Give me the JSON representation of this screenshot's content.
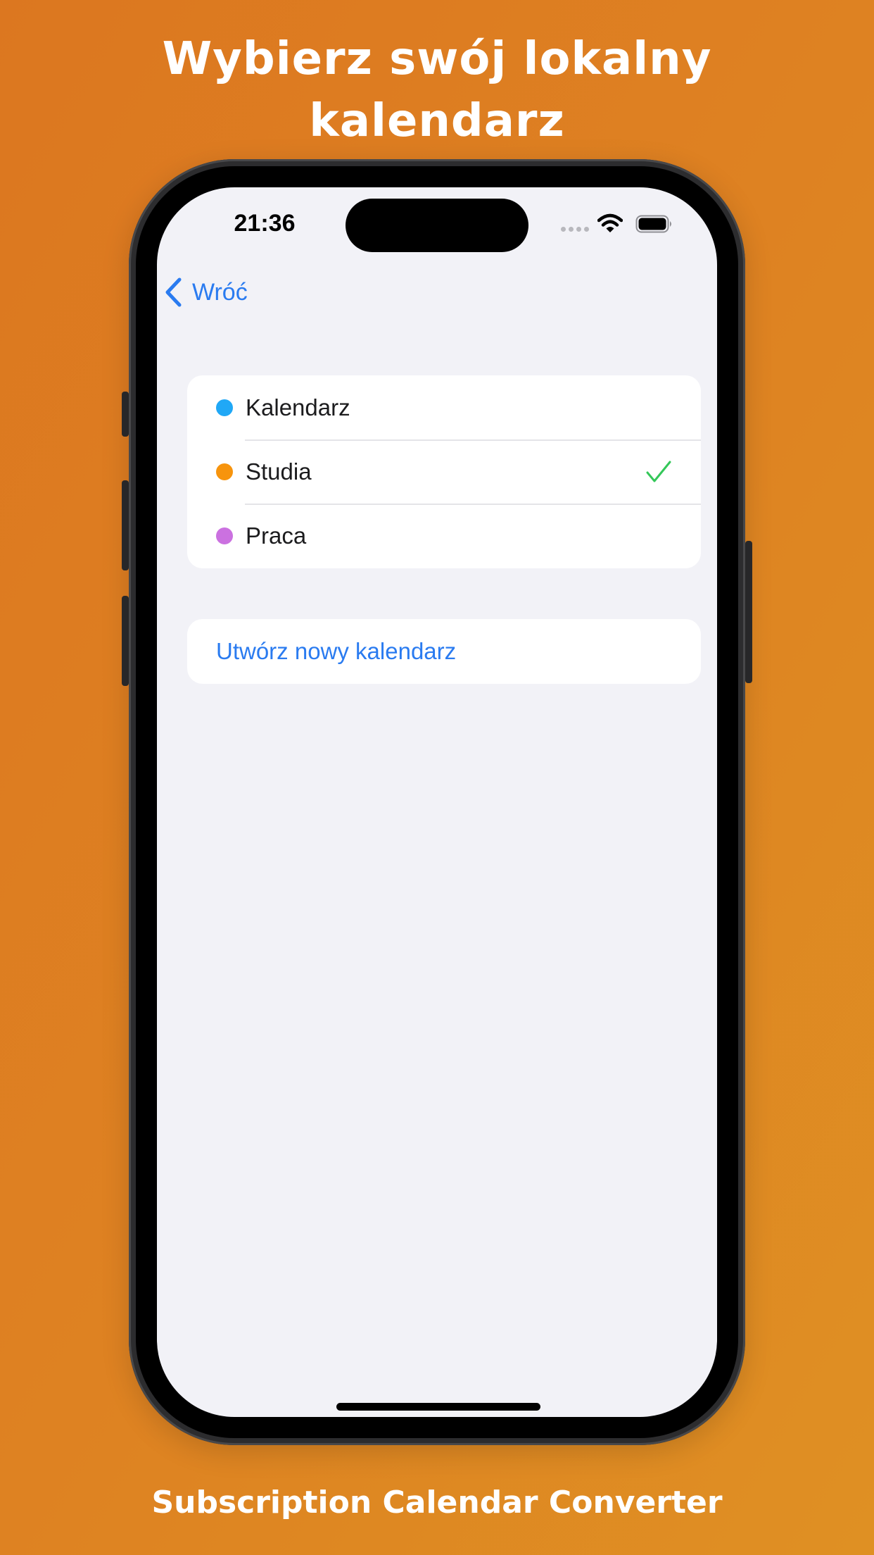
{
  "headline": {
    "line1": "Wybierz swój lokalny",
    "line2": "kalendarz"
  },
  "footer": {
    "app_name": "Subscription Calendar Converter"
  },
  "status_bar": {
    "time": "21:36",
    "icons": [
      "cellular-dots-icon",
      "wifi-icon",
      "battery-icon"
    ]
  },
  "nav": {
    "back_label": "Wróć",
    "back_icon": "chevron-left-icon"
  },
  "calendars": [
    {
      "label": "Kalendarz",
      "color": "#20a8f6",
      "selected": false
    },
    {
      "label": "Studia",
      "color": "#f7940d",
      "selected": true
    },
    {
      "label": "Praca",
      "color": "#cb71e0",
      "selected": false
    }
  ],
  "actions": {
    "create_label": "Utwórz nowy kalendarz"
  },
  "colors": {
    "background_gradient": [
      "#dc7720",
      "#df9023"
    ],
    "accent_blue": "#2a7bf0",
    "check_green": "#34c759",
    "screen_bg": "#f2f2f7"
  }
}
